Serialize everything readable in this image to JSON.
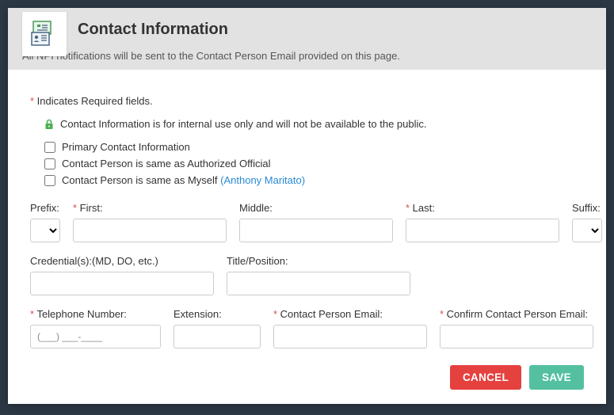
{
  "header": {
    "title": "Contact Information",
    "subtitle": "All NPI notifications will be sent to the Contact Person Email provided on this page."
  },
  "body": {
    "required_note": "Indicates Required fields.",
    "internal_note": "Contact Information is for internal use only and will not be available to the public.",
    "checkboxes": {
      "primary": "Primary Contact Information",
      "same_official": "Contact Person is same as Authorized Official",
      "same_myself_prefix": "Contact Person is same as Myself ",
      "same_myself_name": "(Anthony  Maritato)"
    },
    "labels": {
      "prefix": "Prefix:",
      "first": "First:",
      "middle": "Middle:",
      "last": "Last:",
      "suffix": "Suffix:",
      "credentials": "Credential(s):(MD, DO, etc.)",
      "title_position": "Title/Position:",
      "telephone": "Telephone Number:",
      "extension": "Extension:",
      "email": "Contact Person Email:",
      "confirm_email": "Confirm Contact Person Email:"
    },
    "values": {
      "prefix": "",
      "first": "",
      "middle": "",
      "last": "",
      "suffix": "",
      "credentials": "",
      "title_position": "",
      "telephone": "(___) ___-____",
      "extension": "",
      "email": "",
      "confirm_email": ""
    }
  },
  "footer": {
    "cancel": "CANCEL",
    "save": "SAVE"
  },
  "required_marker": "* "
}
